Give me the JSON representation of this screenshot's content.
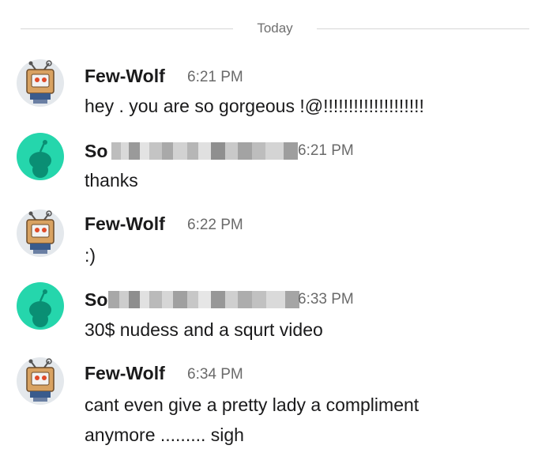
{
  "divider_label": "Today",
  "icons": {
    "few_wolf_avatar": "robot-snoo-avatar-icon",
    "so_avatar": "default-snoo-avatar-icon"
  },
  "colors": {
    "so_avatar_bg": "#25d6ac",
    "snoo_dark": "#0a8f74"
  },
  "messages": [
    {
      "author": "Few-Wolf",
      "time": "6:21 PM",
      "lines": [
        "hey . you are so gorgeous !@!!!!!!!!!!!!!!!!!!!!"
      ]
    },
    {
      "author": "So",
      "time": "6:21 PM",
      "lines": [
        "thanks"
      ]
    },
    {
      "author": "Few-Wolf",
      "time": "6:22 PM",
      "lines": [
        ":)"
      ]
    },
    {
      "author": "So",
      "time": "6:33 PM",
      "lines": [
        "30$ nudess and a squrt video"
      ]
    },
    {
      "author": "Few-Wolf",
      "time": "6:34 PM",
      "lines": [
        "cant even give a pretty lady a compliment",
        "anymore ......... sigh"
      ]
    }
  ]
}
